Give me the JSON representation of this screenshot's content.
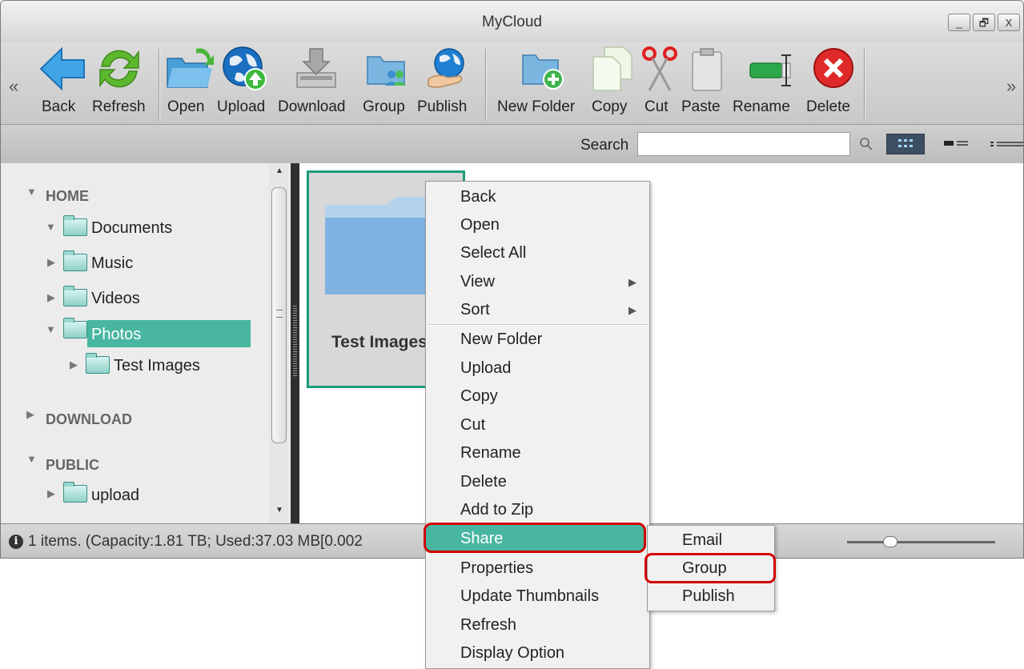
{
  "window": {
    "title": "MyCloud",
    "controls": {
      "minimize": "_",
      "restore": "🗗",
      "close": "X"
    }
  },
  "toolbar": {
    "scroll_left": "«",
    "scroll_right": "»",
    "buttons": [
      {
        "label": "Back",
        "icon": "back-arrow-icon"
      },
      {
        "label": "Refresh",
        "icon": "refresh-icon"
      },
      {
        "label": "Open",
        "icon": "open-folder-icon"
      },
      {
        "label": "Upload",
        "icon": "upload-globe-icon"
      },
      {
        "label": "Download",
        "icon": "download-icon"
      },
      {
        "label": "Group",
        "icon": "group-icon"
      },
      {
        "label": "Publish",
        "icon": "publish-icon"
      },
      {
        "label": "New Folder",
        "icon": "new-folder-icon"
      },
      {
        "label": "Copy",
        "icon": "copy-icon"
      },
      {
        "label": "Cut",
        "icon": "scissors-icon"
      },
      {
        "label": "Paste",
        "icon": "paste-icon"
      },
      {
        "label": "Rename",
        "icon": "rename-icon"
      },
      {
        "label": "Delete",
        "icon": "delete-icon"
      }
    ]
  },
  "search": {
    "label": "Search",
    "value": ""
  },
  "sidebar": {
    "home": "HOME",
    "documents": "Documents",
    "music": "Music",
    "videos": "Videos",
    "photos": "Photos",
    "test_images": "Test Images",
    "download": "DOWNLOAD",
    "public": "PUBLIC",
    "upload": "upload"
  },
  "main": {
    "item_label": "Test Images"
  },
  "status": {
    "text": "1 items. (Capacity:1.81 TB; Used:37.03 MB[0.002"
  },
  "context_menu": {
    "items": [
      "Back",
      "Open",
      "Select All",
      "View",
      "Sort",
      "New Folder",
      "Upload",
      "Copy",
      "Cut",
      "Rename",
      "Delete",
      "Add to Zip",
      "Share",
      "Properties",
      "Update Thumbnails",
      "Refresh",
      "Display Option"
    ],
    "submenu_arrow": "▶"
  },
  "share_submenu": {
    "items": [
      "Email",
      "Group",
      "Publish"
    ]
  },
  "colors": {
    "selection": "#48b6a0",
    "highlight_outline": "#d10000",
    "thumb_border": "#1c9d7b"
  }
}
